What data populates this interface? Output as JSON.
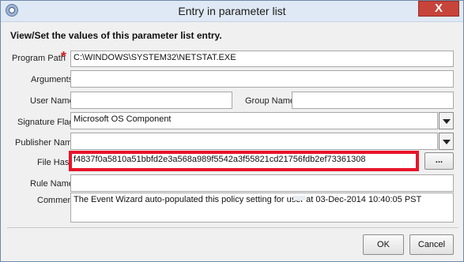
{
  "window": {
    "title": "Entry in parameter list",
    "close_label": "X"
  },
  "heading": "View/Set the values of this parameter list entry.",
  "fields": {
    "program_path": {
      "label": "Program Path",
      "required_mark": "*",
      "value": "C:\\WINDOWS\\SYSTEM32\\NETSTAT.EXE"
    },
    "arguments": {
      "label": "Arguments",
      "value": ""
    },
    "user_name": {
      "label": "User Name",
      "value": ""
    },
    "group_name": {
      "label": "Group Name",
      "value": ""
    },
    "signature_flag": {
      "label": "Signature Flag",
      "value": "Microsoft OS Component"
    },
    "publisher_name": {
      "label": "Publisher Name",
      "value": ""
    },
    "file_hash": {
      "label": "File Hash",
      "value": "f4837f0a5810a51bbfd2e3a568a989f5542a3f55821cd21756fdb2ef73361308",
      "browse_label": "..."
    },
    "rule_name": {
      "label": "Rule Name",
      "value": ""
    },
    "comment": {
      "label": "Comment",
      "value": "The Event Wizard auto-populated this policy setting for user          at 03-Dec-2014 10:40:05 PST"
    }
  },
  "buttons": {
    "ok": "OK",
    "cancel": "Cancel"
  },
  "colors": {
    "highlight": "#e8142a",
    "required": "#cc2222",
    "close": "#c7443a"
  }
}
